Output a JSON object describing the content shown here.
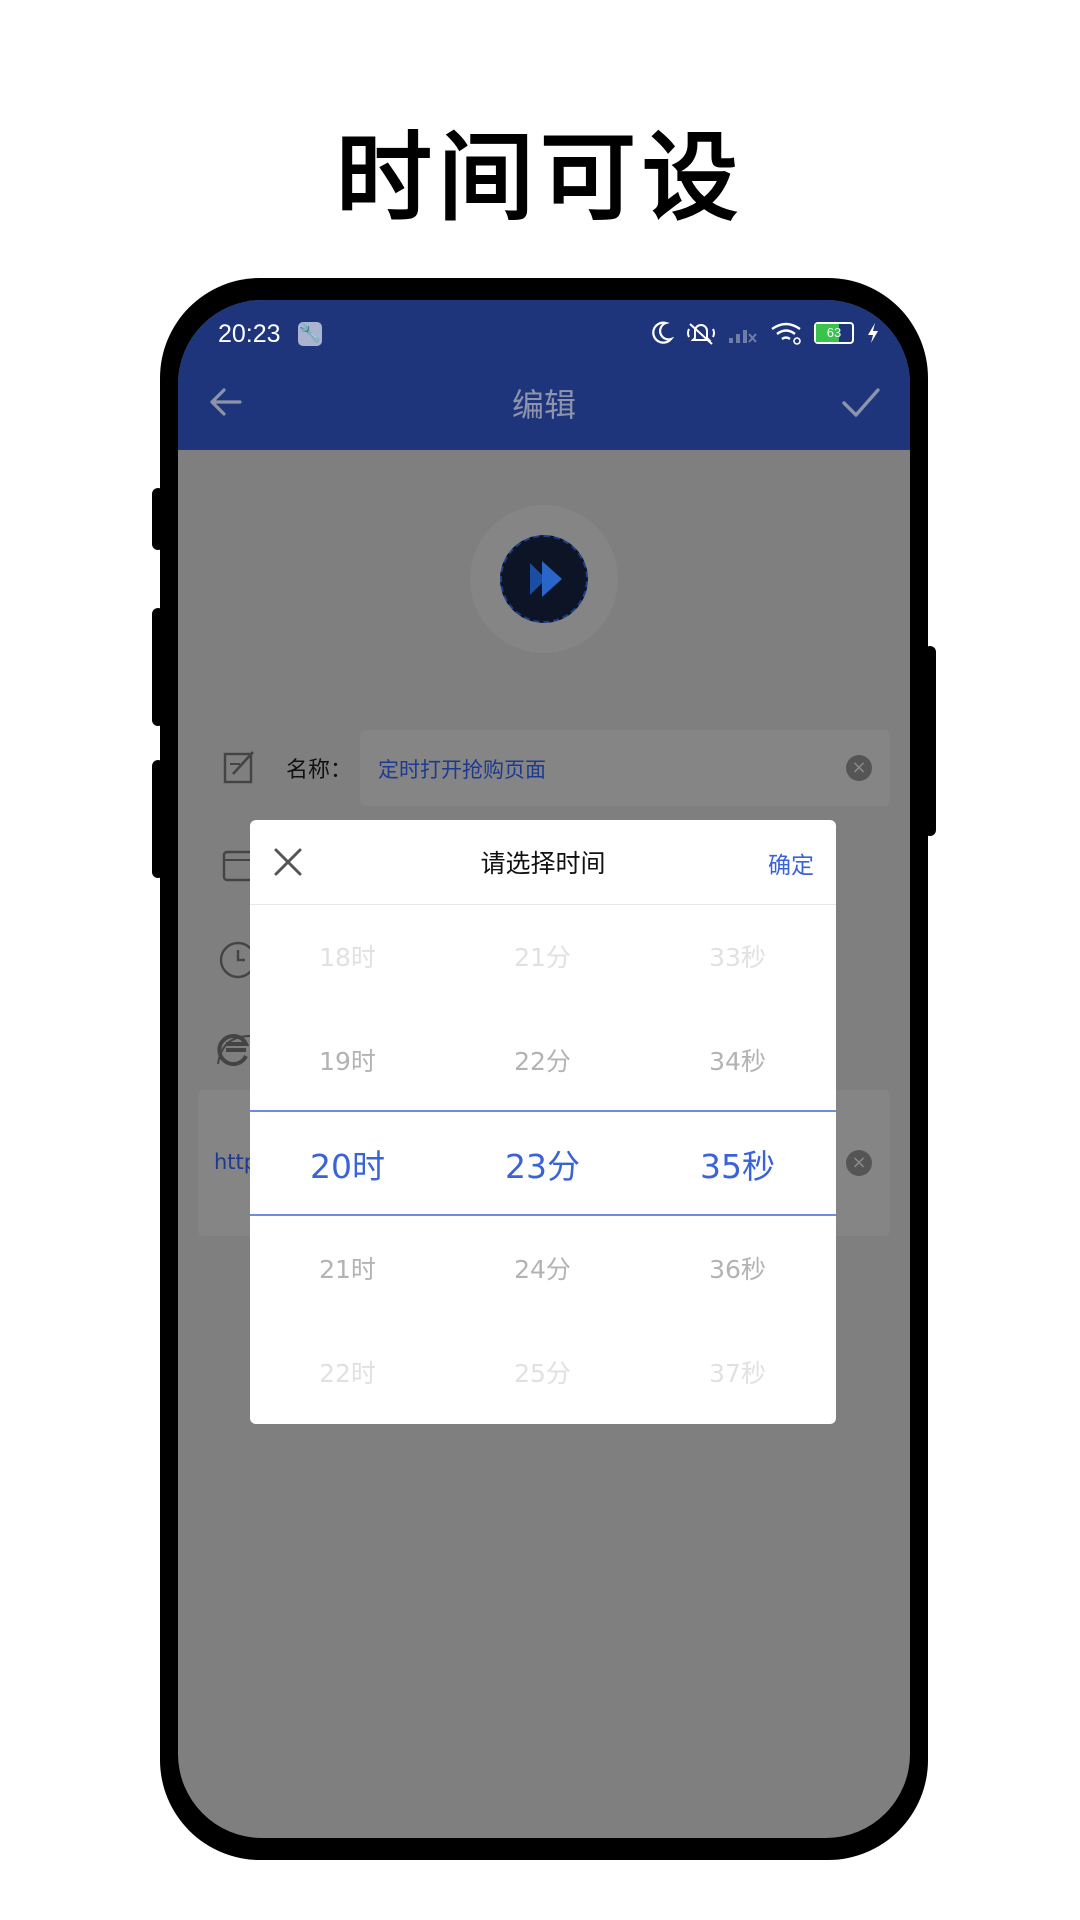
{
  "headline": "时间可设",
  "status_bar": {
    "time": "20:23",
    "battery": "63",
    "battery_level": 0.63,
    "icons": [
      "wrench-icon",
      "moon-icon",
      "mute-icon",
      "signal-icon",
      "wifi-icon",
      "battery-icon",
      "charging-icon"
    ]
  },
  "app_bar": {
    "title": "编辑",
    "back_icon": "arrow-left-icon",
    "confirm_icon": "check-icon"
  },
  "form": {
    "name_label": "名称：",
    "name_value": "定时打开抢购页面",
    "url_value": "http"
  },
  "dialog": {
    "title": "请选择时间",
    "confirm": "确定",
    "hours": [
      "18时",
      "19时",
      "20时",
      "21时",
      "22时"
    ],
    "minutes": [
      "21分",
      "22分",
      "23分",
      "24分",
      "25分"
    ],
    "seconds": [
      "33秒",
      "34秒",
      "35秒",
      "36秒",
      "37秒"
    ],
    "selected": {
      "hour": "20时",
      "minute": "23分",
      "second": "35秒"
    }
  },
  "colors": {
    "app_bar": "#1f357b",
    "accent": "#3a63d6",
    "overlay": "#7f7f7f"
  }
}
